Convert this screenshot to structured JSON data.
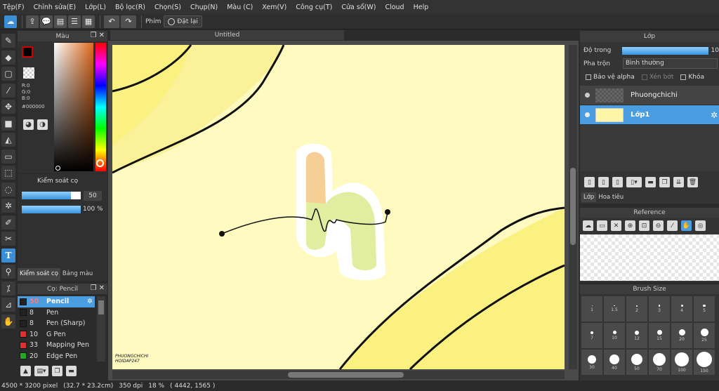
{
  "menu": [
    "Tệp(F)",
    "Chỉnh sửa(E)",
    "Lớp(L)",
    "Bộ lọc(R)",
    "Chọn(S)",
    "Chụp(N)",
    "Màu (C)",
    "Xem(V)",
    "Công cụ(T)",
    "Cửa sổ(W)",
    "Cloud",
    "Help"
  ],
  "toolbar": {
    "phim_label": "Phím",
    "reset_label": "Đặt lại"
  },
  "doc_tab": "Untitled",
  "color_panel": {
    "title": "Màu",
    "r": "R:0",
    "g": "G:0",
    "b": "B:0",
    "hex": "#000000",
    "fg": "#000000",
    "bg": "#ffffff"
  },
  "brush_control": {
    "title": "Kiểm soát cọ",
    "size_value": "50",
    "size_level": 0.83,
    "opacity_value": "100 %",
    "opacity_level": 1.0
  },
  "bottom_tabs": [
    "Kiểm soát cọ",
    "Bảng màu"
  ],
  "brush_list": {
    "title": "Cọ: Pencil",
    "items": [
      {
        "size": "50",
        "name": "Pencil",
        "color": "#222222",
        "selected": true
      },
      {
        "size": "8",
        "name": "Pen",
        "color": "#222222"
      },
      {
        "size": "8",
        "name": "Pen (Sharp)",
        "color": "#222222"
      },
      {
        "size": "10",
        "name": "G Pen",
        "color": "#e03030"
      },
      {
        "size": "33",
        "name": "Mapping Pen",
        "color": "#e03030"
      },
      {
        "size": "20",
        "name": "Edge Pen",
        "color": "#22aa22"
      }
    ]
  },
  "canvas": {
    "signature_line1": "PHUONGCHICHI",
    "signature_line2": "HOIDAP247"
  },
  "layers_panel": {
    "title": "Lớp",
    "opacity_label": "Độ trong",
    "opacity_value": "10",
    "blend_label": "Pha trộn",
    "blend_value": "Bình thường",
    "protect_alpha": "Bảo vệ alpha",
    "clipping": "Xén bớt",
    "lock": "Khóa",
    "layers": [
      {
        "name": "Phuongchichi",
        "selected": false
      },
      {
        "name": "Lớp1",
        "selected": true
      }
    ],
    "tabs": [
      "Lớp",
      "Hoa tiêu"
    ]
  },
  "reference_panel": {
    "title": "Reference"
  },
  "brush_size_panel": {
    "title": "Brush Size",
    "sizes": [
      "1",
      "1.5",
      "2",
      "3",
      "4",
      "5",
      "7",
      "10",
      "12",
      "15",
      "20",
      "25",
      "30",
      "40",
      "50",
      "70",
      "100",
      "150"
    ]
  },
  "status": {
    "pixels": "4500 * 3200 pixel",
    "cm": "(32.7 * 23.2cm)",
    "dpi": "350 dpi",
    "zoom": "18 %",
    "coords": "( 4442, 1565 )"
  }
}
